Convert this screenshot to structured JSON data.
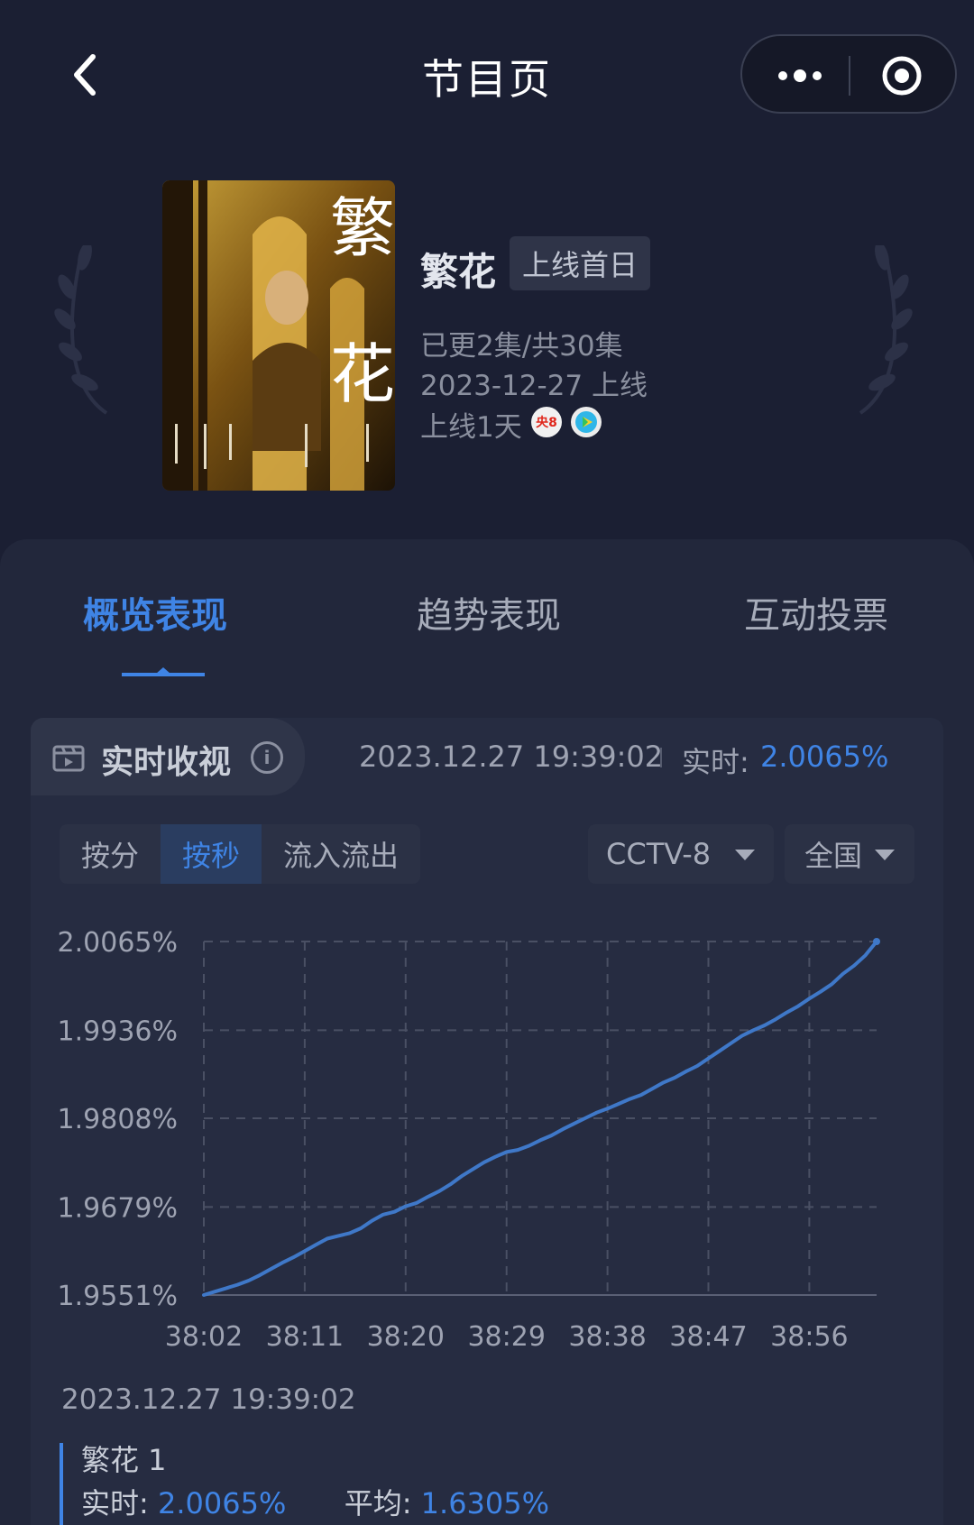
{
  "nav": {
    "title": "节目页",
    "back_icon": "chevron-left-icon",
    "more_icon": "ellipsis-icon",
    "target_icon": "target-icon"
  },
  "program": {
    "name": "繁花",
    "premiere_badge": "上线首日",
    "episodes": "已更2集/共30集",
    "release_date": "2023-12-27 上线",
    "days_online": "上线1天",
    "channel_badge": "央8",
    "poster_title_chars": [
      "繁",
      "花"
    ]
  },
  "tabs": [
    {
      "label": "概览表现",
      "active": true
    },
    {
      "label": "趋势表现",
      "active": false
    },
    {
      "label": "互动投票",
      "active": false
    }
  ],
  "realtime": {
    "title": "实时收视",
    "timestamp": "2023.12.27 19:39:02",
    "label": "实时:",
    "value": "2.0065%"
  },
  "segments": [
    {
      "label": "按分",
      "active": false
    },
    {
      "label": "按秒",
      "active": true
    },
    {
      "label": "流入流出",
      "active": false
    }
  ],
  "filters": {
    "channel": "CCTV-8",
    "region": "全国"
  },
  "chart_data": {
    "type": "line",
    "title": "",
    "xlabel": "",
    "ylabel": "",
    "x_ticks": [
      "38:02",
      "38:11",
      "38:20",
      "38:29",
      "38:38",
      "38:47",
      "38:56"
    ],
    "y_ticks": [
      "1.9551%",
      "1.9679%",
      "1.9808%",
      "1.9936%",
      "2.0065%"
    ],
    "ylim": [
      1.9551,
      2.0065
    ],
    "grid": true,
    "series": [
      {
        "name": "繁花 1",
        "color": "#3f78c8",
        "x_seconds": [
          0,
          1,
          2,
          3,
          4,
          5,
          6,
          7,
          8,
          9,
          10,
          11,
          12,
          13,
          14,
          15,
          16,
          17,
          18,
          19,
          20,
          21,
          22,
          23,
          24,
          25,
          26,
          27,
          28,
          29,
          30,
          31,
          32,
          33,
          34,
          35,
          36,
          37,
          38,
          39,
          40,
          41,
          42,
          43,
          44,
          45,
          46,
          47,
          48,
          49,
          50,
          51,
          52,
          53,
          54,
          55,
          56,
          57,
          58,
          59,
          60
        ],
        "values": [
          1.9551,
          1.9556,
          1.9561,
          1.9566,
          1.9572,
          1.958,
          1.9589,
          1.9598,
          1.9606,
          1.9615,
          1.9624,
          1.9633,
          1.9637,
          1.9641,
          1.9648,
          1.9659,
          1.9668,
          1.9672,
          1.968,
          1.9685,
          1.9694,
          1.9702,
          1.9712,
          1.9724,
          1.9734,
          1.9744,
          1.9752,
          1.9759,
          1.9762,
          1.9768,
          1.9776,
          1.9783,
          1.9792,
          1.98,
          1.9808,
          1.9816,
          1.9822,
          1.9829,
          1.9836,
          1.9842,
          1.9851,
          1.986,
          1.9867,
          1.9876,
          1.9884,
          1.9895,
          1.9906,
          1.9917,
          1.9928,
          1.9936,
          1.9943,
          1.9952,
          1.9962,
          1.9971,
          1.9982,
          1.9992,
          2.0003,
          2.0018,
          2.003,
          2.0045,
          2.0065
        ]
      }
    ]
  },
  "tooltip": {
    "time": "2023.12.27 19:39:02",
    "series_name": "繁花 1",
    "realtime_label": "实时:",
    "realtime_value": "2.0065%",
    "average_label": "平均:",
    "average_value": "1.6305%"
  }
}
